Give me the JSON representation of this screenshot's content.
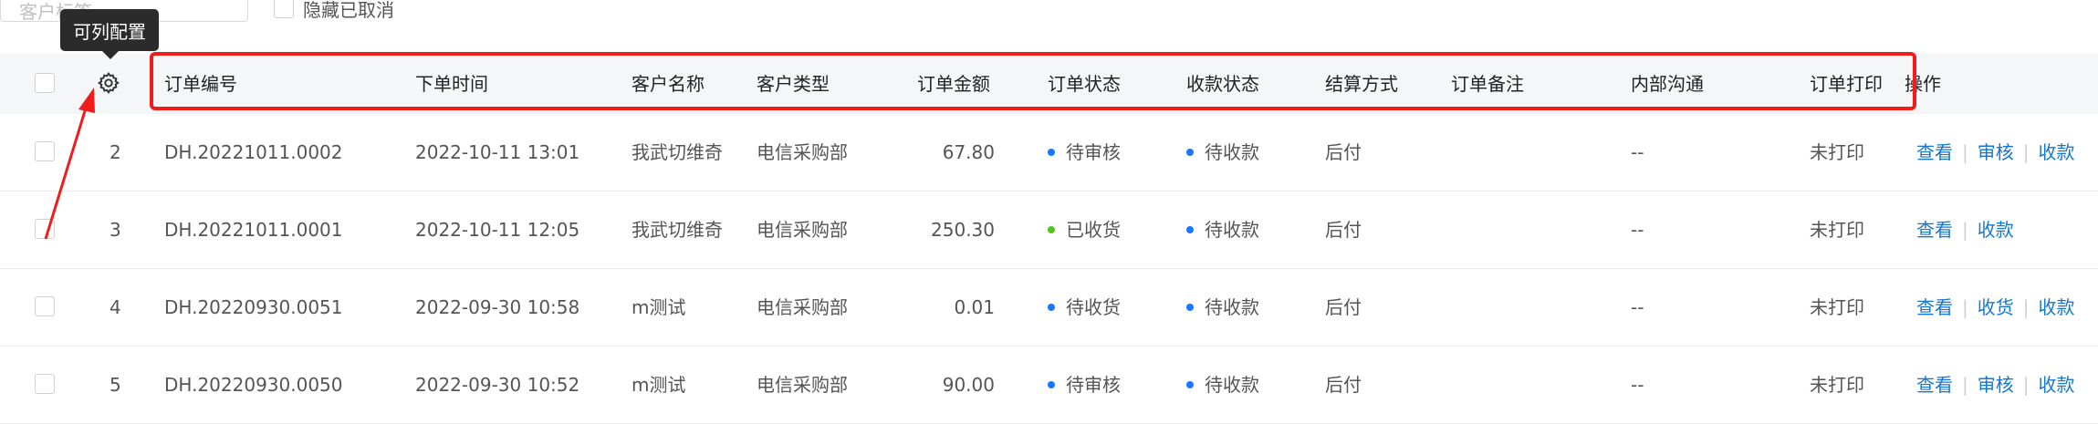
{
  "filter": {
    "customer_tag_placeholder": "客户标签",
    "ellipsis": "···",
    "hide_cancelled_label": "隐藏已取消"
  },
  "tooltip": "可列配置",
  "columns": [
    "订单编号",
    "下单时间",
    "客户名称",
    "客户类型",
    "订单金额",
    "订单状态",
    "收款状态",
    "结算方式",
    "订单备注",
    "内部沟通",
    "订单打印",
    "操作"
  ],
  "colors": {
    "accent_link": "#1677d2",
    "status_blue": "#1677ff",
    "status_green": "#52c41a",
    "highlight_red": "#f21c1c",
    "tooltip_bg": "#2b2b2b"
  },
  "rows": [
    {
      "index": "2",
      "order_no": "DH.20221011.0002",
      "time": "2022-10-11 13:01",
      "customer": "我武切维奇",
      "type": "电信采购部",
      "amount": "67.80",
      "order_status": "待审核",
      "order_status_color": "blue",
      "pay_status": "待收款",
      "settle": "后付",
      "remark": "",
      "internal": "--",
      "print": "未打印",
      "actions": [
        "查看",
        "审核",
        "收款"
      ]
    },
    {
      "index": "3",
      "order_no": "DH.20221011.0001",
      "time": "2022-10-11 12:05",
      "customer": "我武切维奇",
      "type": "电信采购部",
      "amount": "250.30",
      "order_status": "已收货",
      "order_status_color": "green",
      "pay_status": "待收款",
      "settle": "后付",
      "remark": "",
      "internal": "--",
      "print": "未打印",
      "actions": [
        "查看",
        "收款"
      ]
    },
    {
      "index": "4",
      "order_no": "DH.20220930.0051",
      "time": "2022-09-30 10:58",
      "customer": "m测试",
      "type": "电信采购部",
      "amount": "0.01",
      "order_status": "待收货",
      "order_status_color": "blue",
      "pay_status": "待收款",
      "settle": "后付",
      "remark": "",
      "internal": "--",
      "print": "未打印",
      "actions": [
        "查看",
        "收货",
        "收款"
      ]
    },
    {
      "index": "5",
      "order_no": "DH.20220930.0050",
      "time": "2022-09-30 10:52",
      "customer": "m测试",
      "type": "电信采购部",
      "amount": "90.00",
      "order_status": "待审核",
      "order_status_color": "blue",
      "pay_status": "待收款",
      "settle": "后付",
      "remark": "",
      "internal": "--",
      "print": "未打印",
      "actions": [
        "查看",
        "审核",
        "收款"
      ]
    }
  ]
}
